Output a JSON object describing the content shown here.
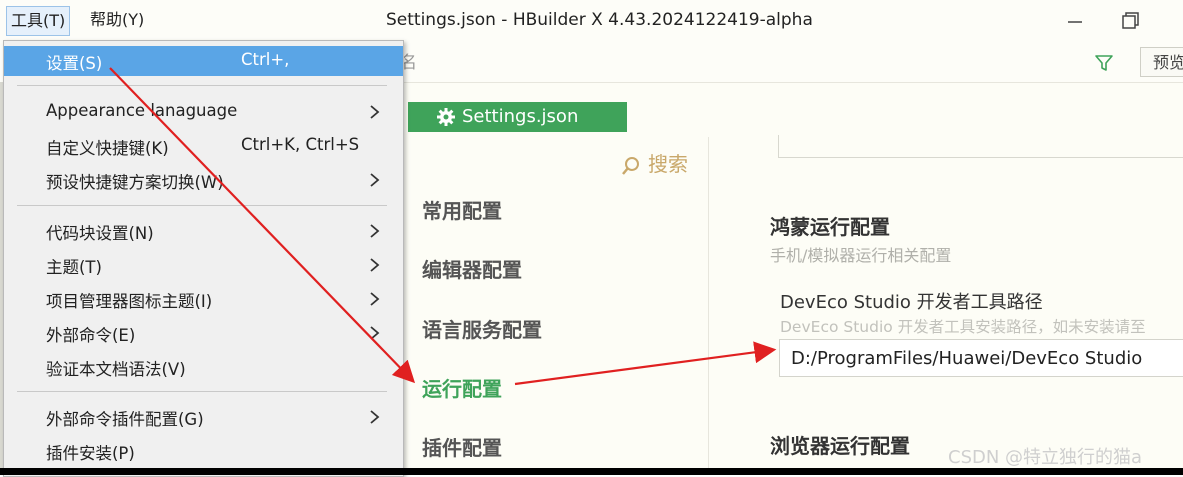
{
  "menubar": {
    "tools_label": "工具(T)",
    "help_label": "帮助(Y)"
  },
  "window": {
    "title": "Settings.json - HBuilder X 4.43.2024122419-alpha"
  },
  "toolbar": {
    "search_text": "名",
    "preview_label": "预览"
  },
  "tab": {
    "label": "Settings.json"
  },
  "settings_nav": {
    "search_label": "搜索",
    "items": [
      {
        "label": "常用配置"
      },
      {
        "label": "编辑器配置"
      },
      {
        "label": "语言服务配置"
      },
      {
        "label": "运行配置"
      },
      {
        "label": "插件配置"
      }
    ],
    "active_index": 3
  },
  "content": {
    "harmony_title": "鸿蒙运行配置",
    "harmony_subtitle": "手机/模拟器运行相关配置",
    "deveco_label": "DevEco Studio 开发者工具路径",
    "deveco_description": "DevEco Studio 开发者工具安装路径，如未安装请至",
    "deveco_path": "D:/ProgramFiles/Huawei/DevEco Studio",
    "browser_title": "浏览器运行配置"
  },
  "dropdown": {
    "items": [
      {
        "label": "设置(S)",
        "shortcut": "Ctrl+,",
        "submenu": false,
        "highlighted": true
      },
      {
        "label": "Appearance lanaguage",
        "shortcut": "",
        "submenu": true
      },
      {
        "label": "自定义快捷键(K)",
        "shortcut": "Ctrl+K, Ctrl+S",
        "submenu": false
      },
      {
        "label": "预设快捷键方案切换(W)",
        "shortcut": "",
        "submenu": true
      },
      {
        "label": "代码块设置(N)",
        "shortcut": "",
        "submenu": true
      },
      {
        "label": "主题(T)",
        "shortcut": "",
        "submenu": true
      },
      {
        "label": "项目管理器图标主题(I)",
        "shortcut": "",
        "submenu": true
      },
      {
        "label": "外部命令(E)",
        "shortcut": "",
        "submenu": true
      },
      {
        "label": "验证本文档语法(V)",
        "shortcut": "",
        "submenu": false
      },
      {
        "label": "外部命令插件配置(G)",
        "shortcut": "",
        "submenu": true
      },
      {
        "label": "插件安装(P)",
        "shortcut": "",
        "submenu": false
      }
    ]
  },
  "watermark": "CSDN @特立独行的猫a",
  "colors": {
    "accent_green": "#3fa35a",
    "menu_highlight": "#5aa5e6",
    "annotation_red": "#e02020",
    "search_gold": "#c9a86a"
  },
  "icons": {
    "gear": "gear-icon",
    "filter": "filter-icon",
    "search": "search-icon",
    "chevron": "chevron-right-icon",
    "minimize": "minimize-icon",
    "restore": "restore-icon"
  }
}
